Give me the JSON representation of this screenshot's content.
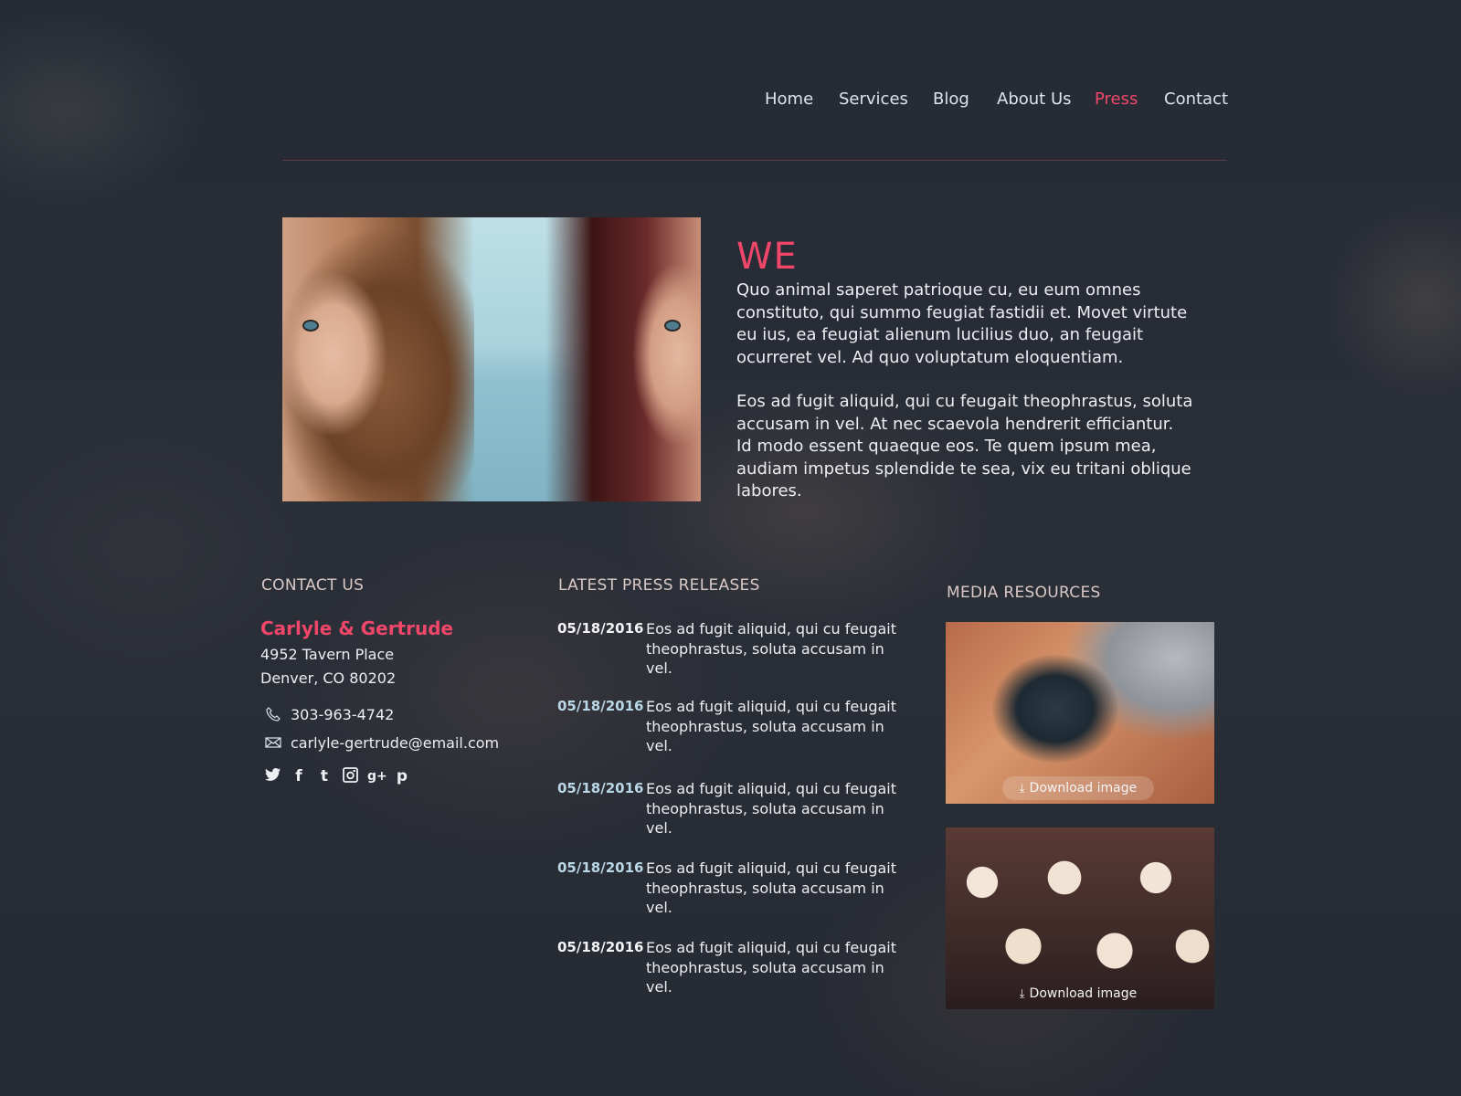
{
  "nav": {
    "items": [
      {
        "label": "Home"
      },
      {
        "label": "Services"
      },
      {
        "label": "Blog"
      },
      {
        "label": "About Us"
      },
      {
        "label": "Press"
      },
      {
        "label": "Contact"
      }
    ],
    "active": "Press"
  },
  "hero": {
    "heading": "WE",
    "paragraphs": [
      "Quo animal saperet patrioque cu, eu eum omnes constituto, qui summo feugiat fastidii et. Movet virtute eu ius, ea feugiat alienum lucilius duo, an feugait ocurreret vel. Ad quo voluptatum eloquentiam.",
      "Eos ad fugit aliquid, qui cu feugait theophrastus, soluta accusam in vel. At nec scaevola hendrerit efficiantur. Id modo essent quaeque eos. Te quem ipsum mea, audiam impetus splendide te sea, vix eu tritani oblique labores."
    ]
  },
  "contact": {
    "heading": "CONTACT US",
    "company": "Carlyle & Gertrude",
    "address_line1": "4952 Tavern Place",
    "address_line2": "Denver, CO 80202",
    "phone": "303-963-4742",
    "email": "carlyle-gertrude@email.com",
    "social": [
      {
        "icon": "twitter-icon",
        "glyph": "🐦"
      },
      {
        "icon": "facebook-icon",
        "glyph": "f"
      },
      {
        "icon": "tumblr-icon",
        "glyph": "t"
      },
      {
        "icon": "instagram-icon",
        "glyph": "◙"
      },
      {
        "icon": "google-plus-icon",
        "glyph": "g+"
      },
      {
        "icon": "pinterest-icon",
        "glyph": "p"
      }
    ]
  },
  "press": {
    "heading": "LATEST PRESS RELEASES",
    "items": [
      {
        "date": "05/18/2016",
        "text": "Eos ad fugit aliquid, qui cu feugait theophrastus, soluta accusam in vel."
      },
      {
        "date": "05/18/2016",
        "text": "Eos ad fugit aliquid, qui cu feugait theophrastus, soluta accusam in vel."
      },
      {
        "date": "05/18/2016",
        "text": "Eos ad fugit aliquid, qui cu feugait theophrastus, soluta accusam in vel."
      },
      {
        "date": "05/18/2016",
        "text": "Eos ad fugit aliquid, qui cu feugait theophrastus, soluta accusam in vel."
      },
      {
        "date": "05/18/2016",
        "text": "Eos ad fugit aliquid, qui cu feugait theophrastus, soluta accusam in vel."
      }
    ]
  },
  "media": {
    "heading": "MEDIA RESOURCES",
    "items": [
      {
        "image": "camera",
        "button_label": "Download image"
      },
      {
        "image": "cupcakes",
        "button_label": "Download image"
      }
    ]
  },
  "colors": {
    "accent": "#f0466a",
    "background": "#262b35",
    "text": "#eceef2"
  }
}
